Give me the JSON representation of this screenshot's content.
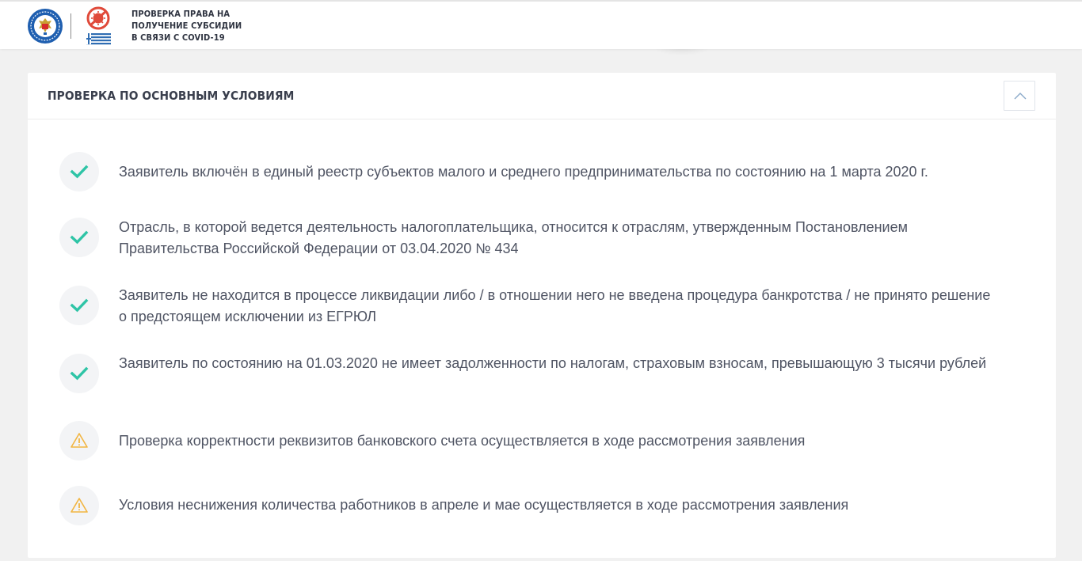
{
  "header": {
    "title_lines": [
      "ПРОВЕРКА ПРАВА НА",
      "ПОЛУЧЕНИЕ СУБСИДИИ",
      "В СВЯЗИ С COVID-19"
    ],
    "logo_fns_icon": "fns-emblem-icon",
    "logo_covid_icon": "covid-stop-icon"
  },
  "card": {
    "title": "ПРОВЕРКА ПО ОСНОВНЫМ УСЛОВИЯМ",
    "collapse_icon": "chevron-up-icon",
    "items": [
      {
        "status": "ok",
        "icon": "check-icon",
        "text": "Заявитель включён в единый реестр субъектов малого и среднего предпринимательства по состоянию на 1 марта 2020 г."
      },
      {
        "status": "ok",
        "icon": "check-icon",
        "text": "Отрасль, в которой ведется деятельность налогоплательщика, относится к отраслям, утвержденным Постановлением Правительства Российской Федерации от 03.04.2020 № 434"
      },
      {
        "status": "ok",
        "icon": "check-icon",
        "text": "Заявитель не находится в процессе ликвидации либо / в отношении него не введена процедура банкротства / не принято решение о предстоящем исключении из ЕГРЮЛ"
      },
      {
        "status": "ok",
        "icon": "check-icon",
        "text": "Заявитель по состоянию на 01.03.2020 не имеет задолженности по налогам, страховым взносам, превышающую 3 тысячи рублей"
      },
      {
        "status": "warning",
        "icon": "warning-icon",
        "text": "Проверка корректности реквизитов банковского счета осуществляется в ходе рассмотрения заявления"
      },
      {
        "status": "warning",
        "icon": "warning-icon",
        "text": "Условия неснижения количества работников в апреле и мае осуществляется в ходе рассмотрения заявления"
      }
    ]
  },
  "colors": {
    "check": "#2ec4a6",
    "warning": "#f2b541",
    "badge_bg": "#f3f4f6",
    "text": "#4f5463",
    "page_bg": "#f1f1f1"
  }
}
